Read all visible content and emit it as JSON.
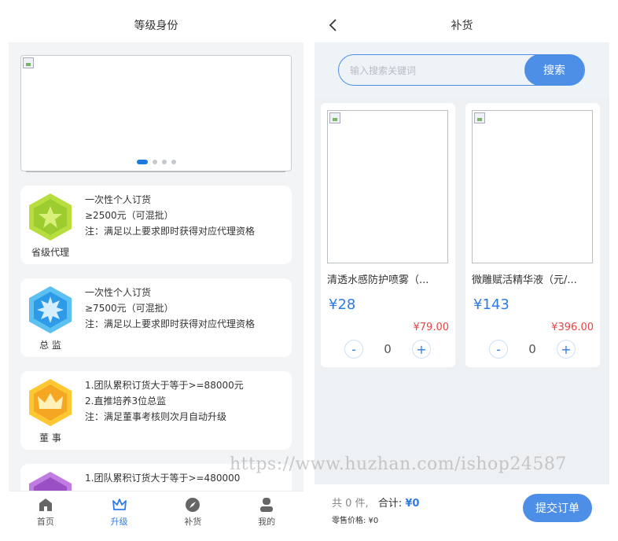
{
  "left": {
    "title": "等级身份",
    "banner_dots": 4,
    "levels": [
      {
        "name": "省级代理",
        "badge_icon": "star-icon",
        "badge_color": "#9ccc2f",
        "lines": [
          "一次性个人订货",
          "≥2500元（可混批）",
          "注：满足以上要求即时获得对应代理资格"
        ]
      },
      {
        "name": "总 监",
        "badge_icon": "sun-icon",
        "badge_color": "#2e9be8",
        "lines": [
          "一次性个人订货",
          "≥7500元（可混批）",
          "注：满足以上要求即时获得对应代理资格"
        ]
      },
      {
        "name": "董 事",
        "badge_icon": "crown-icon",
        "badge_color": "#f5a623",
        "lines": [
          "1.团队累积订货大于等于>=88000元",
          "2.直推培养3位总监",
          "注：满足董事考核则次月自动升级"
        ]
      },
      {
        "name": "",
        "badge_icon": "gem-icon",
        "badge_color": "#9b4fc4",
        "lines": [
          "1.团队累积订货大于等于>=480000"
        ]
      }
    ],
    "tabs": [
      {
        "label": "首页",
        "icon": "home-icon",
        "active": false
      },
      {
        "label": "升级",
        "icon": "crown-icon",
        "active": true
      },
      {
        "label": "补货",
        "icon": "compass-icon",
        "active": false
      },
      {
        "label": "我的",
        "icon": "user-icon",
        "active": false
      }
    ]
  },
  "right": {
    "title": "补货",
    "search": {
      "placeholder": "输入搜索关键词",
      "button": "搜索"
    },
    "products": [
      {
        "name": "清透水感防护喷雾（...",
        "price": "¥28",
        "original_price": "¥79.00",
        "qty": "0",
        "minus": "-",
        "plus": "+"
      },
      {
        "name": "微雕赋活精华液（元/...",
        "price": "¥143",
        "original_price": "¥396.00",
        "qty": "0",
        "minus": "-",
        "plus": "+"
      }
    ],
    "watermark": "https://www.huzhan.com/ishop24587",
    "cart": {
      "count_text": "共 0 件,",
      "total_label": "合计:",
      "total_value": "¥0",
      "retail_text": "零售价格: ¥0",
      "submit": "提交订单"
    }
  }
}
